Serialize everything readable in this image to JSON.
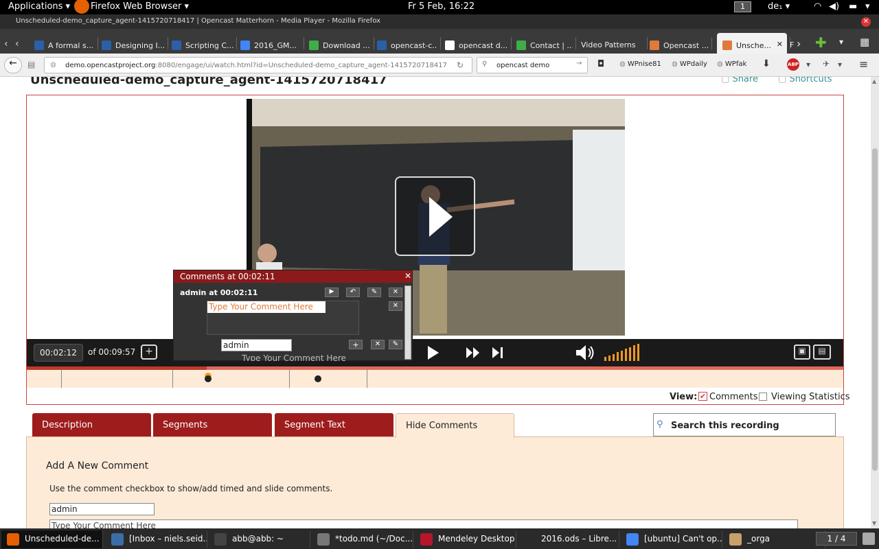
{
  "gnome": {
    "applications": "Applications",
    "app_menu": "Firefox Web Browser",
    "clock": "Fr  5 Feb, 16:22",
    "workspace": "1",
    "keyboard": "de₁"
  },
  "window": {
    "title": "Unscheduled-demo_capture_agent-1415720718417 | Opencast Matterhorn - Media Player - Mozilla Firefox"
  },
  "tabs": [
    {
      "label": "A formal s...",
      "color": "#2b5fa8"
    },
    {
      "label": "Designing I...",
      "color": "#2b5fa8"
    },
    {
      "label": "Scripting C...",
      "color": "#2b5fa8"
    },
    {
      "label": "2016_GM...",
      "color": "#4285f4"
    },
    {
      "label": "Download ...",
      "color": "#3fae49"
    },
    {
      "label": "opencast-c...",
      "color": "#2b5fa8"
    },
    {
      "label": "opencast d...",
      "color": "#ffffff"
    },
    {
      "label": "Contact | ...",
      "color": "#3fae49"
    },
    {
      "label": "Video Patterns",
      "color": ""
    },
    {
      "label": "Opencast ...",
      "color": "#e07a3a"
    },
    {
      "label": "Unsche...",
      "color": "#e07a3a"
    },
    {
      "label": "F",
      "color": ""
    }
  ],
  "nav": {
    "url_host": "demo.opencastproject.org",
    "url_rest": ":8080/engage/ui/watch.html?id=Unscheduled-demo_capture_agent-1415720718417",
    "search": "opencast demo",
    "bookmarks": [
      "WPnise81",
      "WPdaily",
      "WPfak"
    ]
  },
  "page": {
    "title": "Unscheduled-demo_capture_agent-1415720718417",
    "share": "Share",
    "shortcuts": "Shortcuts"
  },
  "player": {
    "current_time": "00:02:12",
    "of_label": "of",
    "duration": "00:09:57",
    "progress": 0.22
  },
  "popup": {
    "header": "Comments at 00:02:11",
    "entry_author": "admin at 00:02:11",
    "placeholder": "Type Your Comment Here",
    "name_value": "admin",
    "reply_placeholder": "Type Your Comment Here"
  },
  "view": {
    "label": "View:",
    "comments": "Comments",
    "stats": "Viewing Statistics"
  },
  "page_tabs": {
    "description": "Description",
    "segments": "Segments",
    "segment_text": "Segment Text",
    "hide_comments": "Hide Comments",
    "search": "Search this recording"
  },
  "add_comment": {
    "heading": "Add A New Comment",
    "help": "Use the comment checkbox to show/add timed and slide comments.",
    "name_value": "admin",
    "text_placeholder": "Type Your Comment Here"
  },
  "taskbar": [
    {
      "label": "Unscheduled-de...",
      "color": "#e66000"
    },
    {
      "label": "[Inbox – niels.seid...",
      "color": "#3b6ea8"
    },
    {
      "label": "abb@abb: ~",
      "color": "#444444"
    },
    {
      "label": "*todo.md (~/Doc...",
      "color": "#777777"
    },
    {
      "label": "Mendeley Desktop",
      "color": "#b5162a"
    },
    {
      "label": "2016.ods – Libre...",
      "color": "#2a2a2a"
    },
    {
      "label": "[ubuntu] Can't op...",
      "color": "#4285f4"
    },
    {
      "label": "_orga",
      "color": "#c8a06a"
    }
  ],
  "workspace_pager": "1 / 4"
}
